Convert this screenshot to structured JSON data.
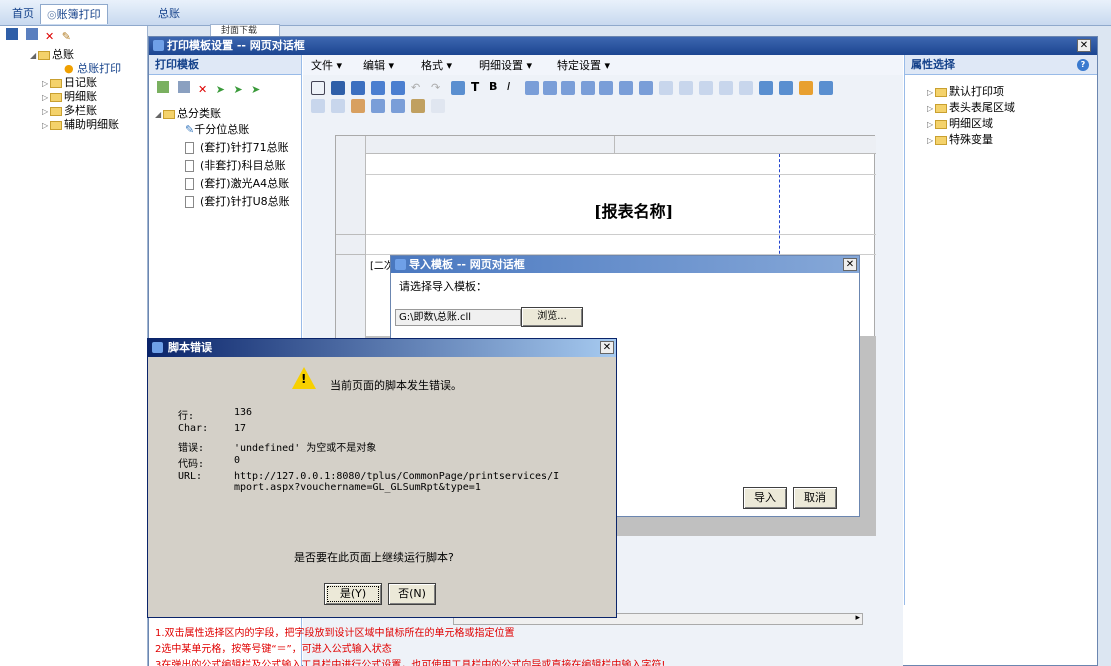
{
  "tabs": {
    "home": "首页",
    "ledger_print": "账簿打印",
    "general_ledger": "总账",
    "back_tab": "封面下载"
  },
  "left_tree": {
    "root": "总账",
    "root_child": "总账打印",
    "items": [
      "日记账",
      "明细账",
      "多栏账",
      "辅助明细账"
    ]
  },
  "main_window": {
    "title": "打印模板设置 -- 网页对话框",
    "template_panel_title": "打印模板",
    "template_tree": {
      "root": "总分类账",
      "items": [
        "千分位总账",
        "(套打)针打71总账",
        "(非套打)科目总账",
        "(套打)激光A4总账",
        "(套打)针打U8总账"
      ]
    },
    "menus": [
      "文件 ▾",
      "编辑 ▾",
      "格式 ▾",
      "明细设置 ▾",
      "特定设置 ▾"
    ],
    "report_title": "[报表名称]",
    "cell_text": "[二次",
    "property_panel_title": "属性选择",
    "property_items": [
      "默认打印项",
      "表头表尾区域",
      "明细区域",
      "特殊变量"
    ],
    "hints": [
      "2选中某单元格，按等号键“＝”，可进入公式输入状态",
      "3在弹出的公式编辑栏及公式输入工具栏中进行公式设置，也可使用工具栏中的公式向导或直接在编辑栏中输入字符!"
    ],
    "hint_partial": "1.双击属性选择区内的字段，把字段放到设计区域中鼠标所在的单元格或指定位置"
  },
  "import_dialog": {
    "title": "导入模板 -- 网页对话框",
    "prompt": "请选择导入模板：",
    "path_value": "G:\\即数\\总账.cll",
    "browse_label": "浏览...",
    "import_label": "导入",
    "cancel_label": "取消"
  },
  "script_error_dialog": {
    "title": "脚本错误",
    "message": "当前页面的脚本发生错误。",
    "rows": [
      {
        "label": "行:",
        "value": "136"
      },
      {
        "label": "Char:",
        "value": "17"
      },
      {
        "label": "错误:",
        "value": "'undefined' 为空或不是对象"
      },
      {
        "label": "代码:",
        "value": "0"
      },
      {
        "label": "URL:",
        "value": "http://127.0.0.1:8080/tplus/CommonPage/printservices/Import.aspx?vouchername=GL_GLSumRpt&type=1"
      }
    ],
    "question": "是否要在此页面上继续运行脚本?",
    "yes_label": "是(Y)",
    "no_label": "否(N)"
  },
  "colors": {
    "title_bar": "#1c4591",
    "dialog_bg": "#d4d0c8",
    "hint_red": "#e00000"
  }
}
